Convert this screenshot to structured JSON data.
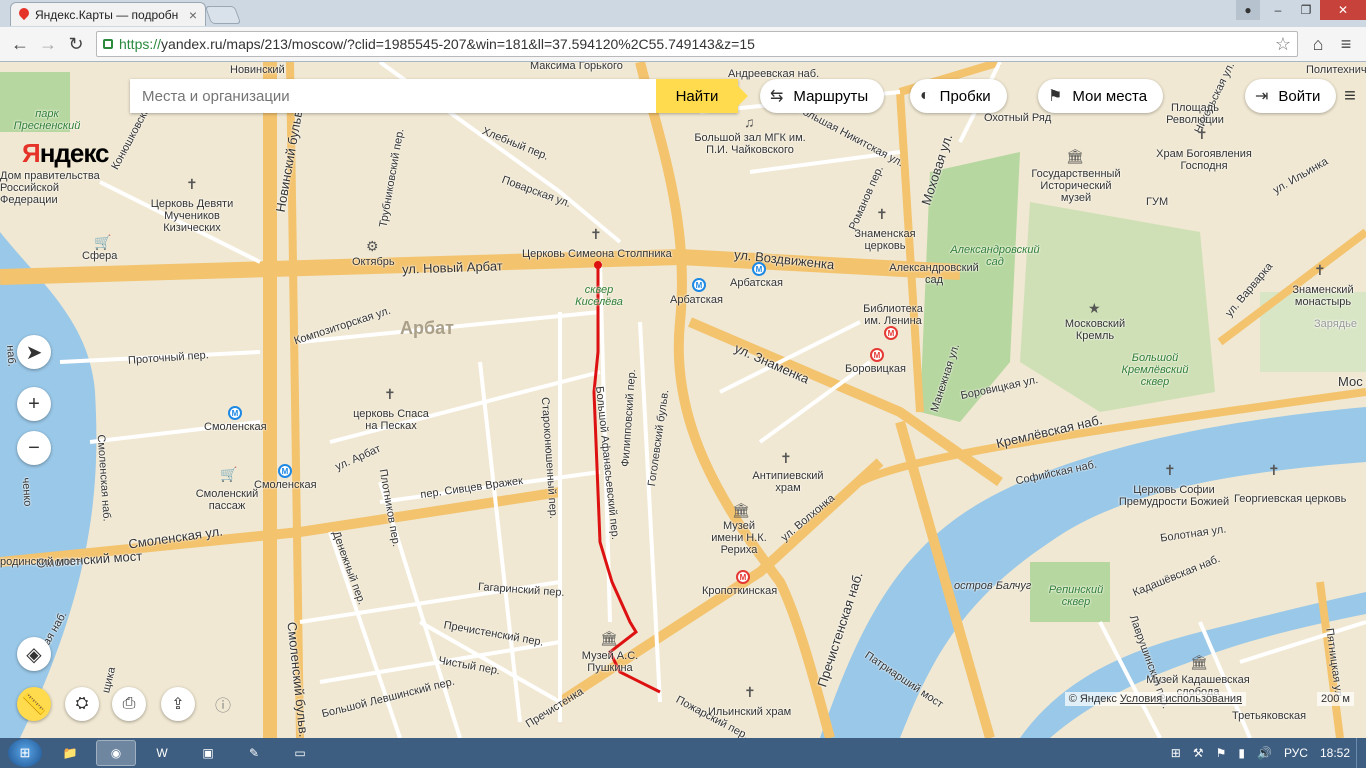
{
  "browser": {
    "tab_title": "Яндекс.Карты — подробн",
    "tab_close": "×",
    "url_https": "https://",
    "url_rest": "yandex.ru/maps/213/moscow/?clid=1985545-207&win=181&ll=37.594120%2C55.749143&z=15",
    "window_controls": {
      "minimize": "‒",
      "maximize": "❐",
      "close": "✕",
      "user": "●"
    }
  },
  "map_ui": {
    "logo_y": "Я",
    "logo_rest": "ндекс",
    "search_placeholder": "Места и организации",
    "find_button": "Найти",
    "routes_button": "Маршруты",
    "traffic_button": "Пробки",
    "my_places_button": "Мои места",
    "login_button": "Войти",
    "attribution_brand": "© Яндекс",
    "attribution_terms": "Условия использования",
    "scale_label": "200 м"
  },
  "map_labels": {
    "arbat_district": "Арбат",
    "novy_arbat": "ул. Новый Арбат",
    "vozdvizhenka": "ул. Воздвиженка",
    "znamenka": "ул. Знаменка",
    "kremlevskaya": "Кремлёвская наб.",
    "sofiyskaya": "Софийская наб.",
    "prechistenskaya_nab": "Пречистенская наб.",
    "smolenskaya_ul": "Смоленская ул.",
    "gogolevsky": "Гоголевский бульв.",
    "b_afanasyevsky": "Большой Афанасьевский пер.",
    "filippovsky": "Филипповский пер.",
    "ul_arbat": "ул. Арбат",
    "sivtsev": "пер. Сивцев Вражек",
    "gagarinsky": "Гагаринский пер.",
    "prechistensky_per": "Пречистенский пер.",
    "volkhonka": "ул. Волхонка",
    "mokhovaya": "Моховая ул.",
    "starokonyushenny": "Староконюшенный пер.",
    "povarskaya": "Поварская ул.",
    "kompozitorskaya": "Композиторская ул.",
    "protochny": "Проточный пер.",
    "plotnikov": "Плотников пер.",
    "denezhny": "Денежный пер.",
    "smolensky_most": "Смоленский мост",
    "novinsky": "Новинский бульв.",
    "smolensky_bulv": "Смоленский бульв.",
    "smolenskaya_nab": "Смоленская наб.",
    "borovitskaya_ul": "Боровицкая ул.",
    "bolotnaya": "Болотная ул.",
    "kadashevskaya": "Кадашёвская наб.",
    "patriarshy": "Патриарший мост",
    "varvarka": "ул. Варварка",
    "ilyinka": "ул. Ильинка",
    "manezhnaya": "Манежная ул.",
    "mos": "Мос",
    "chisty": "Чистый пер.",
    "b_levshinsky": "Большой Левшинский пер.",
    "prechistenka": "Пречистенка",
    "pozharsky": "Пожарский пер.",
    "trubnikovsky": "Трубниковский пер.",
    "khlebny": "Хлебный пер.",
    "sq_kiseleva": "сквер Киселёва",
    "arbatskaya": "Арбатская",
    "arbatskaya2": "Арбатская",
    "smolenskaya1": "Смоленская",
    "smolenskaya2": "Смоленская",
    "borovitskaya": "Боровицкая",
    "kropotkinskaya": "Кропоткинская",
    "biblioteka": "Библиотека им. Ленина",
    "alexandrovsky_sad": "Александровский сад",
    "alexandrovsky_sad2": "Александровский сад",
    "kreml": "Московский Кремль",
    "b_kreml_sq": "Большой Кремлёвский сквер",
    "gum": "ГУМ",
    "ist_muzey": "Государственный Исторический музей",
    "okhotny": "Охотный Ряд",
    "ploshchad_rev": "Площадь Революции",
    "khram_bogoyavl": "Храм Богоявления Господня",
    "znamensky_mon": "Знаменский монастырь",
    "zaryadye": "Зарядье",
    "ts_sofii": "Церковь Софии Премудрости Божией",
    "georgievskaya": "Георгиевская церковь",
    "ostrov": "остров Балчуг",
    "repinsky": "Репинский сквер",
    "kadashi": "Музей Кадашевская слобода",
    "tretyakovskaya": "Третьяковская",
    "antipievsky": "Антипиевский храм",
    "rerikh": "Музей имени Н.К. Рериха",
    "pushkin": "Музей А.С. Пушкина",
    "ilyinsky": "Ильинский храм",
    "spasa": "церковь Спаса на Песках",
    "smolensky_passazh": "Смоленский пассаж",
    "simeon": "Церковь Симеона Столпника",
    "oktyabr": "Октябрь",
    "sfera": "Сфера",
    "devyati": "Церковь Девяти Мучеников Кизических",
    "pravitelstvo": "Дом правительства Российской Федерации",
    "presnensky": "парк Пресненский",
    "konyushkovskaya": "Конюшковская ул.",
    "mgk": "Большой зал МГК им. П.И. Чайковского",
    "znamenskaya_ts": "Знаменская церковь",
    "romanov": "Романов пер.",
    "b_nikitskaya": "Большая Никитская ул.",
    "gorkogo": "Максима Горького",
    "andreevskaya": "Андреевская наб.",
    "politeh": "Политехнич",
    "novinsky_bl": "Новинский",
    "lavrushinsky": "Лаврушинский пер.",
    "pyatnitskaya": "Пятницкая ул.",
    "nikolskaya": "Никольская ул.",
    "nab_l": "наб.",
    "vechnko": "ченко",
    "rodinsky": "родинский мост",
    "ovskaya": "овская наб.",
    "shchika": "щика",
    "bolsh": "Больш",
    "znamenskaya_r": "Знаменская церковь"
  },
  "taskbar": {
    "start": "⊞",
    "lang": "РУС",
    "time": "18:52"
  }
}
